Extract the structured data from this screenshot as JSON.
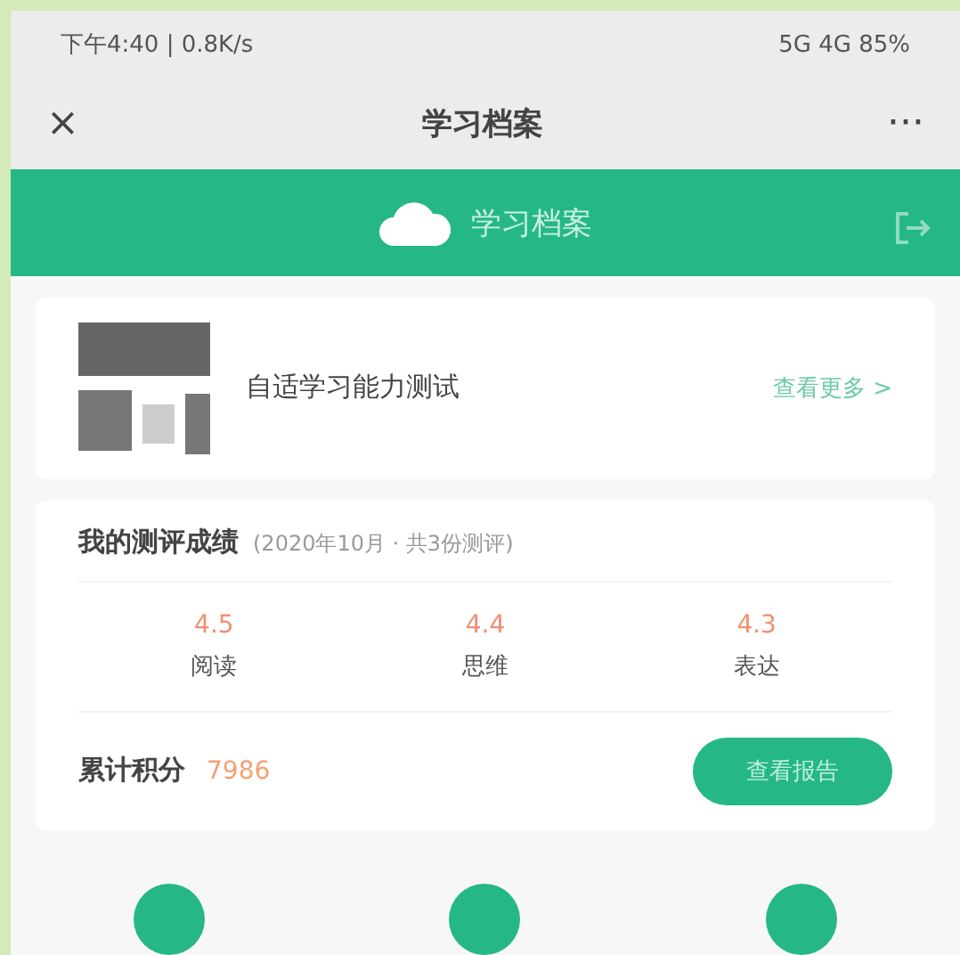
{
  "status_bar": {
    "left": "下午4:40 | 0.8K/s",
    "right": "5G 4G 85%"
  },
  "nav": {
    "close": "×",
    "title": "学习档案",
    "more": "···"
  },
  "banner": {
    "title": "学习档案"
  },
  "profile": {
    "name": "自适学习能力测试",
    "link": "查看更多 >"
  },
  "scores": {
    "title": "我的测评成绩",
    "subtitle": "(2020年10月 · 共3份测评)",
    "items": [
      {
        "value": "4.5",
        "label": "阅读"
      },
      {
        "value": "4.4",
        "label": "思维"
      },
      {
        "value": "4.3",
        "label": "表达"
      }
    ],
    "total_label": "累计积分",
    "total_value": "7986",
    "button": "查看报告"
  },
  "bottom_icons": [
    {
      "kind": "circle"
    },
    {
      "kind": "circle"
    },
    {
      "kind": "circle"
    }
  ]
}
